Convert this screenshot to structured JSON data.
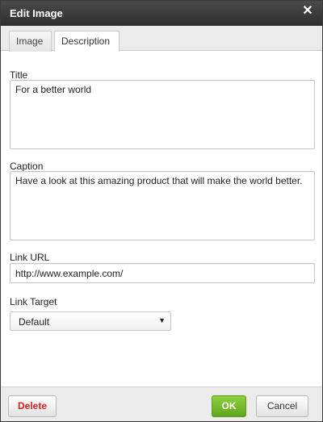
{
  "dialog": {
    "title": "Edit Image",
    "close_icon": "close-icon"
  },
  "tabs": [
    {
      "label": "Image",
      "active": false
    },
    {
      "label": "Description",
      "active": true
    }
  ],
  "form": {
    "title_label": "Title",
    "title_value": "For a better world",
    "caption_label": "Caption",
    "caption_value": "Have a look at this amazing product that will make the world better.",
    "link_url_label": "Link URL",
    "link_url_value": "http://www.example.com/",
    "link_target_label": "Link Target",
    "link_target_value": "Default"
  },
  "footer": {
    "delete_label": "Delete",
    "ok_label": "OK",
    "cancel_label": "Cancel"
  },
  "colors": {
    "titlebar": "#3a3a3a",
    "ok_button": "#6cb52a",
    "delete_text": "#d82020"
  }
}
